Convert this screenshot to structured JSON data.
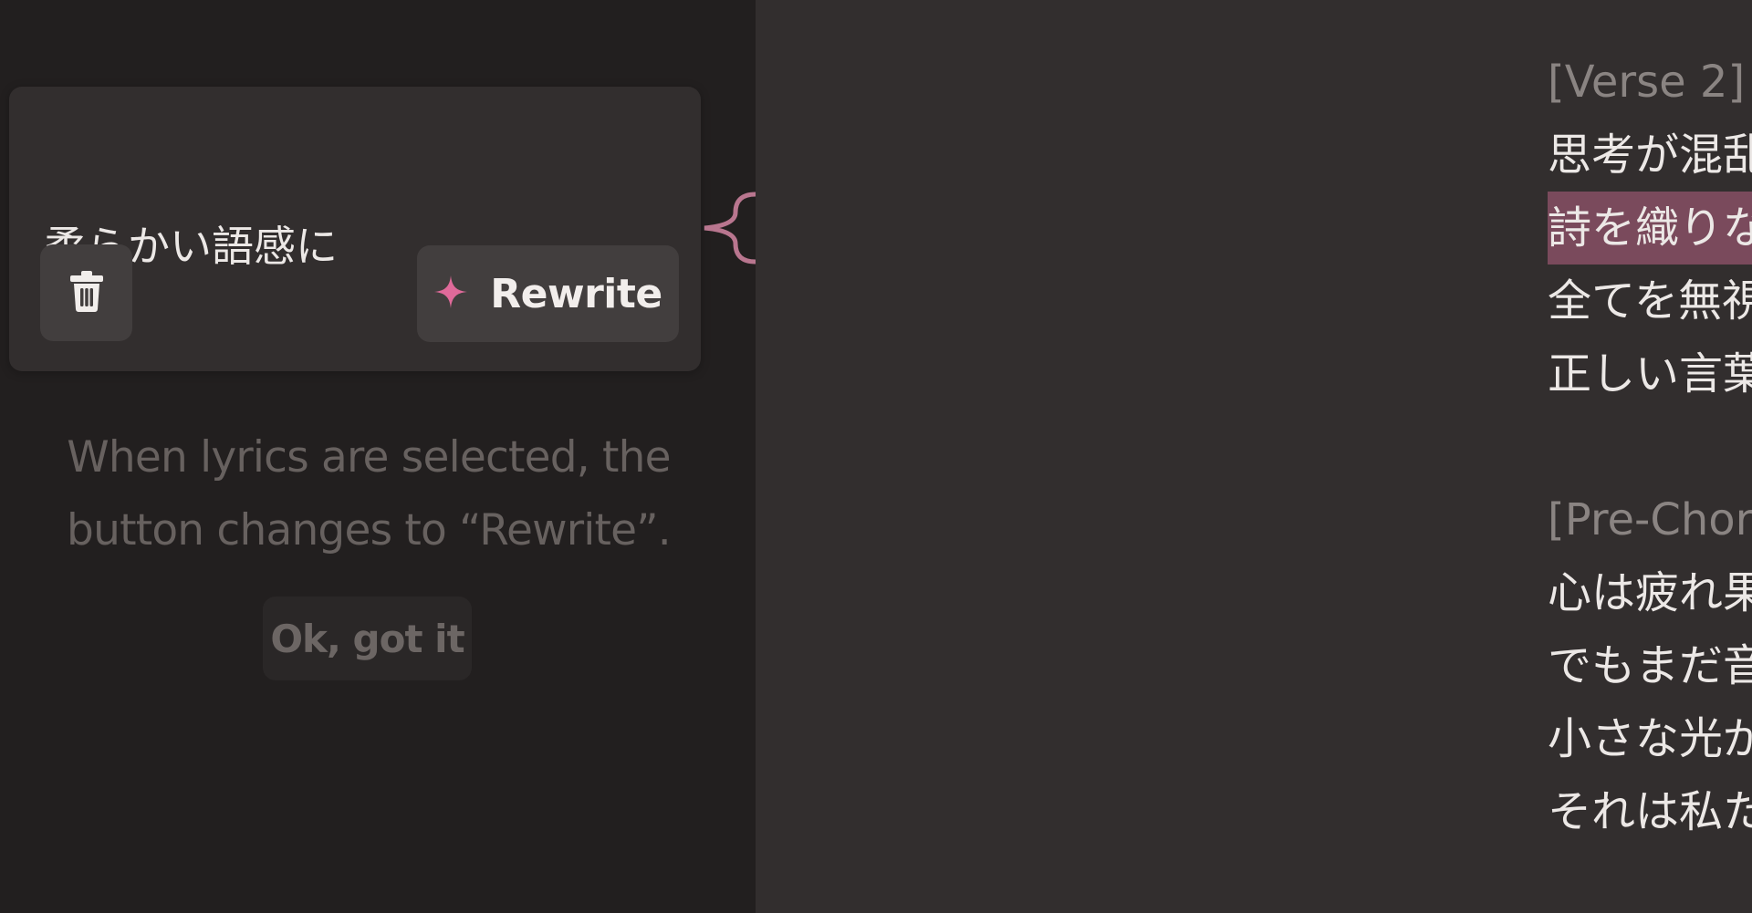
{
  "popover": {
    "instruction": "柔らかい語感に",
    "delete_icon": "trash-icon",
    "rewrite_icon": "sparkle-icon",
    "rewrite_label": "Rewrite",
    "accent_color": "#e06a9a"
  },
  "tip": {
    "line1": "When lyrics are selected, the",
    "line2": "button changes to “Rewrite”.",
    "ok_label": "Ok, got it"
  },
  "lyrics": {
    "verse2_header": "[Verse 2]",
    "verse2_line1": "思考が混乱し、気持ちが沈む",
    "verse2_line2_selected": "詩を織りなすのはなかなか難しい",
    "verse2_line3": "全てを無視する衝動に駆られる",
    "verse2_line4": "正しい言葉を探し求める",
    "prechorus_header": "[Pre-Chorus]",
    "prechorus_line1": "心は疲れ果てて、言の葉は枯れ果てて",
    "prechorus_line2": "でもまだ音楽の中には希望がある",
    "prechorus_line3": "小さな光がまだ見える",
    "prechorus_line4": "それは私たちがまだやり遂げられるという証",
    "selection_color": "#7a4a5c"
  }
}
